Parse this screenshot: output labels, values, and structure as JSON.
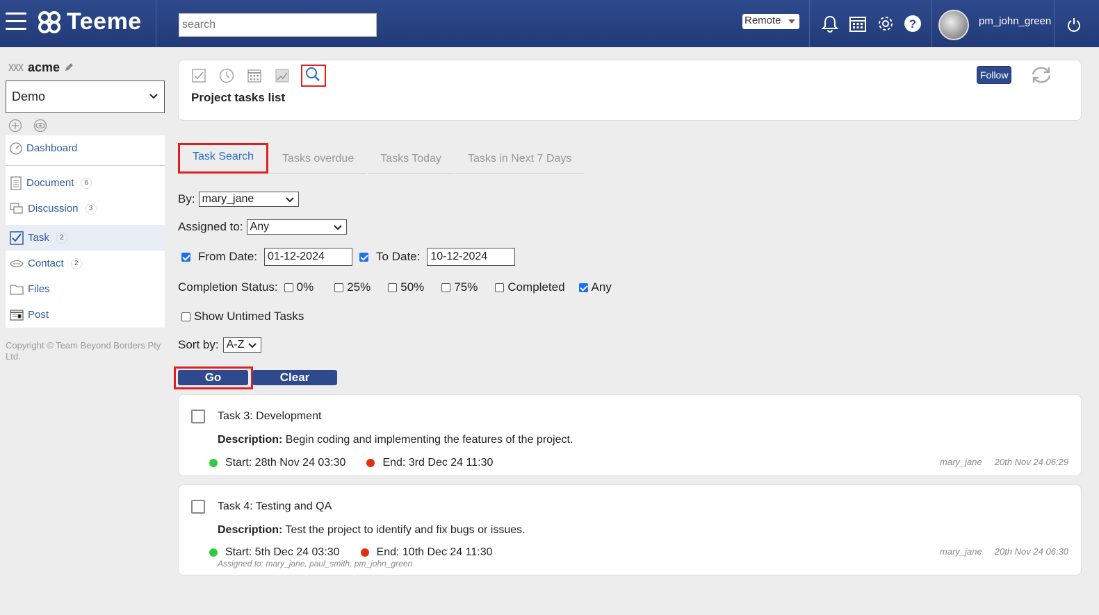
{
  "app": {
    "logo_text": "Teeme",
    "search_placeholder": "search",
    "mode": "Remote",
    "username": "pm_john_green"
  },
  "sidebar": {
    "workspace": "acme",
    "project": "Demo",
    "items": [
      {
        "label": "Dashboard",
        "icon": "dashboard-icon"
      },
      {
        "label": "Document",
        "count": "6",
        "icon": "document-icon"
      },
      {
        "label": "Discussion",
        "count": "3",
        "icon": "discussion-icon"
      },
      {
        "label": "Task",
        "count": "2",
        "icon": "task-icon"
      },
      {
        "label": "Contact",
        "count": "2",
        "icon": "contact-icon"
      },
      {
        "label": "Files",
        "icon": "folder-icon"
      },
      {
        "label": "Post",
        "icon": "post-icon"
      }
    ],
    "copyright": "Copyright © Team Beyond Borders Pty Ltd."
  },
  "header": {
    "title": "Project tasks list",
    "follow_label": "Follow"
  },
  "tabs": [
    "Task Search",
    "Tasks overdue",
    "Tasks Today",
    "Tasks in Next 7 Days"
  ],
  "form": {
    "by_label": "By:",
    "by_value": "mary_jane",
    "assigned_label": "Assigned to:",
    "assigned_value": "Any",
    "from_label": "From Date:",
    "from_value": "01-12-2024",
    "to_label": "To Date:",
    "to_value": "10-12-2024",
    "completion_label": "Completion Status:",
    "completion_options": [
      "0%",
      "25%",
      "50%",
      "75%",
      "Completed",
      "Any"
    ],
    "completion_checked": "Any",
    "untimed_label": "Show Untimed Tasks",
    "sort_label": "Sort by:",
    "sort_value": "A-Z",
    "go_label": "Go",
    "clear_label": "Clear"
  },
  "tasks": [
    {
      "title": "Task 3: Development",
      "desc_label": "Description:",
      "desc": "Begin coding and implementing the features of the project.",
      "start": "Start: 28th Nov 24 03:30",
      "end": "End: 3rd Dec 24 11:30",
      "user": "mary_jane",
      "created": "20th Nov 24 06:29"
    },
    {
      "title": "Task 4: Testing and QA",
      "desc_label": "Description:",
      "desc": "Test the project to identify and fix bugs or issues.",
      "start": "Start: 5th Dec 24 03:30",
      "end": "End: 10th Dec 24 11:30",
      "user": "mary_jane",
      "created": "20th Nov 24 06:30",
      "assigned": "Assigned to: mary_jane, paul_smith, pm_john_green"
    }
  ]
}
